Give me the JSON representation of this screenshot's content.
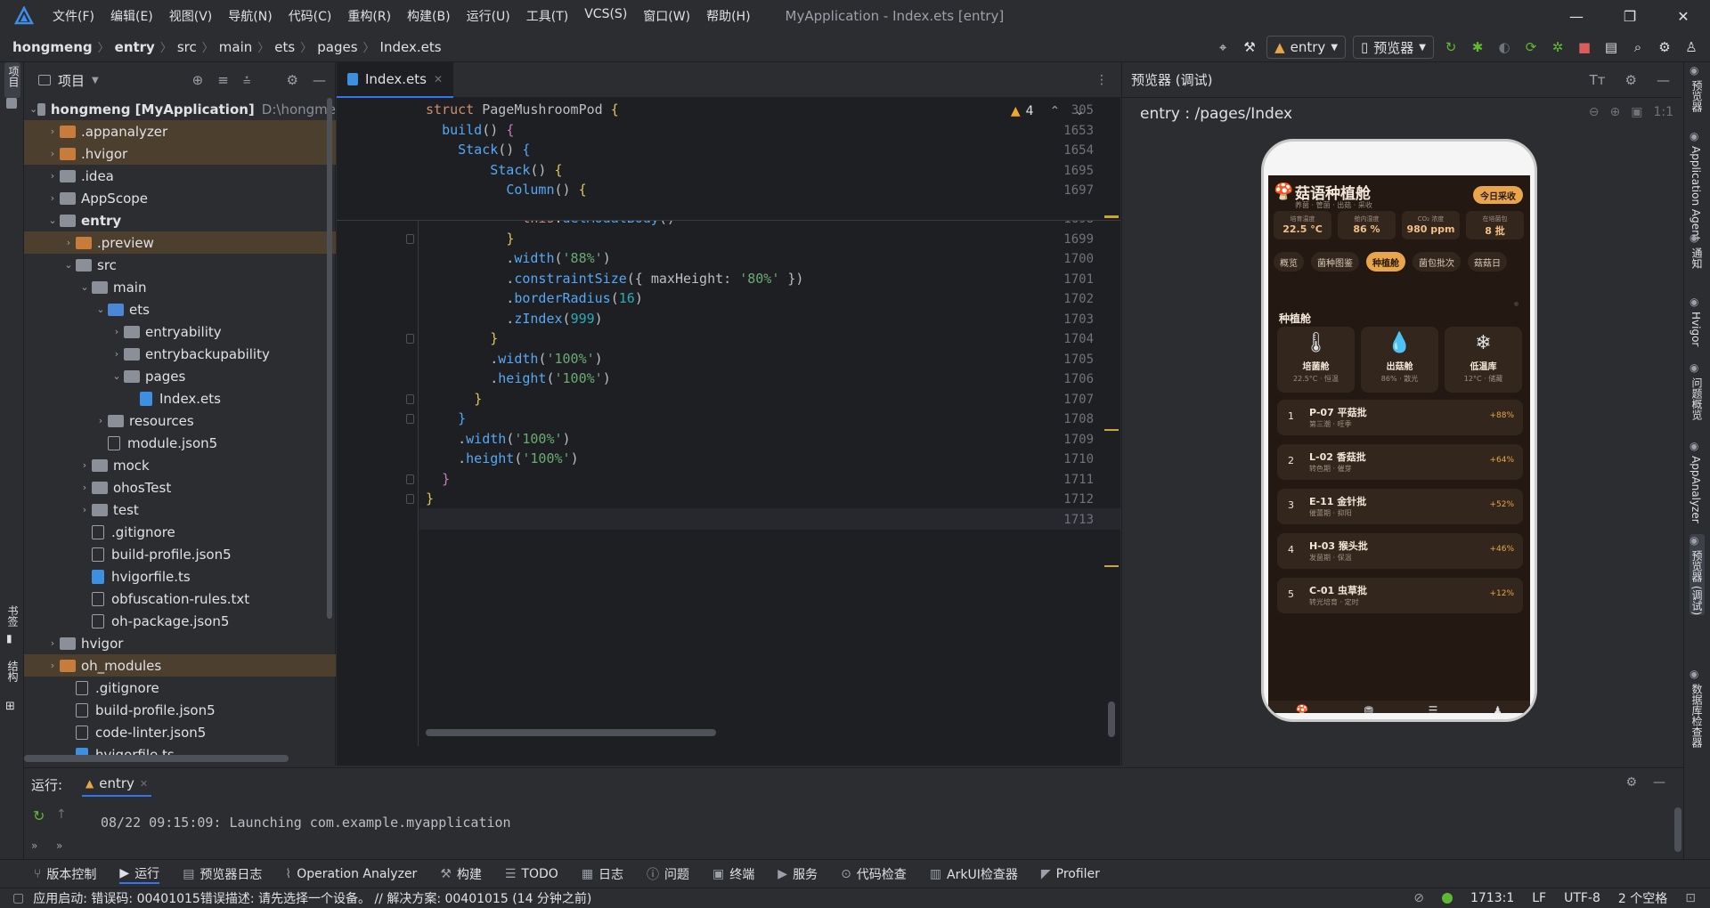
{
  "menu": {
    "items": [
      "文件(F)",
      "编辑(E)",
      "视图(V)",
      "导航(N)",
      "代码(C)",
      "重构(R)",
      "构建(B)",
      "运行(U)",
      "工具(T)",
      "VCS(S)",
      "窗口(W)",
      "帮助(H)"
    ],
    "window_title": "MyApplication - Index.ets [entry]"
  },
  "breadcrumb": [
    "hongmeng",
    "entry",
    "src",
    "main",
    "ets",
    "pages",
    "Index.ets"
  ],
  "toolbar": {
    "run_config": "entry",
    "device": "预览器"
  },
  "left_strip": {
    "project": "项目",
    "bookmarks": "书签",
    "structure": "结构"
  },
  "project": {
    "title": "项目",
    "tree": [
      {
        "label": "hongmeng [MyApplication]",
        "extra": "D:\\hongme",
        "depth": 0,
        "kind": "root",
        "open": true
      },
      {
        "label": ".appanalyzer",
        "depth": 1,
        "kind": "orange",
        "open": false,
        "hl": true
      },
      {
        "label": ".hvigor",
        "depth": 1,
        "kind": "orange",
        "open": false,
        "hl": true
      },
      {
        "label": ".idea",
        "depth": 1,
        "kind": "gray",
        "open": false
      },
      {
        "label": "AppScope",
        "depth": 1,
        "kind": "gray",
        "open": false
      },
      {
        "label": "entry",
        "depth": 1,
        "kind": "gray",
        "open": true,
        "bold": true
      },
      {
        "label": ".preview",
        "depth": 2,
        "kind": "orange",
        "open": false,
        "hl": true
      },
      {
        "label": "src",
        "depth": 2,
        "kind": "gray",
        "open": true
      },
      {
        "label": "main",
        "depth": 3,
        "kind": "gray",
        "open": true
      },
      {
        "label": "ets",
        "depth": 4,
        "kind": "blue",
        "open": true
      },
      {
        "label": "entryability",
        "depth": 5,
        "kind": "gray",
        "open": false
      },
      {
        "label": "entrybackupability",
        "depth": 5,
        "kind": "gray",
        "open": false
      },
      {
        "label": "pages",
        "depth": 5,
        "kind": "gray",
        "open": true
      },
      {
        "label": "Index.ets",
        "depth": 6,
        "kind": "ets"
      },
      {
        "label": "resources",
        "depth": 4,
        "kind": "gray",
        "open": false
      },
      {
        "label": "module.json5",
        "depth": 4,
        "kind": "json"
      },
      {
        "label": "mock",
        "depth": 3,
        "kind": "gray",
        "open": false
      },
      {
        "label": "ohosTest",
        "depth": 3,
        "kind": "gray",
        "open": false
      },
      {
        "label": "test",
        "depth": 3,
        "kind": "gray",
        "open": false
      },
      {
        "label": ".gitignore",
        "depth": 3,
        "kind": "file"
      },
      {
        "label": "build-profile.json5",
        "depth": 3,
        "kind": "json"
      },
      {
        "label": "hvigorfile.ts",
        "depth": 3,
        "kind": "ts"
      },
      {
        "label": "obfuscation-rules.txt",
        "depth": 3,
        "kind": "file"
      },
      {
        "label": "oh-package.json5",
        "depth": 3,
        "kind": "json"
      },
      {
        "label": "hvigor",
        "depth": 1,
        "kind": "gray",
        "open": false
      },
      {
        "label": "oh_modules",
        "depth": 1,
        "kind": "orange",
        "open": false,
        "hl": true
      },
      {
        "label": ".gitignore",
        "depth": 2,
        "kind": "file"
      },
      {
        "label": "build-profile.json5",
        "depth": 2,
        "kind": "json"
      },
      {
        "label": "code-linter.json5",
        "depth": 2,
        "kind": "json"
      },
      {
        "label": "hvigorfile.ts",
        "depth": 2,
        "kind": "ts"
      }
    ]
  },
  "editor": {
    "tab": "Index.ets",
    "warnings": "4",
    "sticky": [
      {
        "ln": "305",
        "html": "<span class='kw'>struct</span> <span class='gr'>PageMushroomPod</span> <span class='yl'>{</span>"
      },
      {
        "ln": "1653",
        "html": "  <span class='fn'>build</span><span class='gr'>()</span> <span class='pk'>{</span>"
      },
      {
        "ln": "1654",
        "html": "    <span class='fn'>Stack</span><span class='gr'>()</span> <span class='fn'>{</span>"
      },
      {
        "ln": "1695",
        "html": "        <span class='fn'>Stack</span><span class='gr'>()</span> <span class='yl'>{</span>"
      },
      {
        "ln": "1697",
        "html": "          <span class='fn'>Column</span><span class='gr'>()</span> <span class='yl'>{</span>"
      }
    ],
    "lines": [
      {
        "ln": "1698",
        "html": "            <span class='kw'>this</span>.<span class='fn'>delModalBody</span>()"
      },
      {
        "ln": "1699",
        "html": "          <span class='yl'>}</span>"
      },
      {
        "ln": "1700",
        "html": "          .<span class='fn'>width</span>(<span class='st'>'88%'</span>)"
      },
      {
        "ln": "1701",
        "html": "          .<span class='fn'>constraintSize</span>({ maxHeight: <span class='st'>'80%'</span> })"
      },
      {
        "ln": "1702",
        "html": "          .<span class='fn'>borderRadius</span>(<span class='nm'>16</span>)"
      },
      {
        "ln": "1703",
        "html": "          .<span class='fn'>zIndex</span>(<span class='nm'>999</span>)"
      },
      {
        "ln": "1704",
        "html": "        <span class='yl'>}</span>"
      },
      {
        "ln": "1705",
        "html": "        .<span class='fn'>width</span>(<span class='st'>'100%'</span>)"
      },
      {
        "ln": "1706",
        "html": "        .<span class='fn'>height</span>(<span class='st'>'100%'</span>)"
      },
      {
        "ln": "1707",
        "html": "      <span class='yl'>}</span>"
      },
      {
        "ln": "1708",
        "html": "    <span class='fn'>}</span>"
      },
      {
        "ln": "1709",
        "html": "    .<span class='fn'>width</span>(<span class='st'>'100%'</span>)"
      },
      {
        "ln": "1710",
        "html": "    .<span class='fn'>height</span>(<span class='st'>'100%'</span>)"
      },
      {
        "ln": "1711",
        "html": "  <span class='pk'>}</span>"
      },
      {
        "ln": "1712",
        "html": "<span class='yl'>}</span>"
      },
      {
        "ln": "1713",
        "html": ""
      }
    ]
  },
  "preview": {
    "title": "预览器 (调试)",
    "path": "entry : /pages/Index",
    "zoom": "1:1",
    "app": {
      "title": "菇语种植舱",
      "subtitle": "养菌 · 管菌 · 出菇 · 采收",
      "harvest_btn": "今日采收",
      "metrics": [
        {
          "label": "培育温度",
          "value": "22.5 °C"
        },
        {
          "label": "舱内湿度",
          "value": "86 %"
        },
        {
          "label": "CO₂ 浓度",
          "value": "980 ppm"
        },
        {
          "label": "在培菌包",
          "value": "8 批"
        }
      ],
      "chips": [
        "概览",
        "菌种图鉴",
        "种植舱",
        "菌包批次",
        "菇菇日"
      ],
      "active_chip": "种植舱",
      "section": "种植舱",
      "cards": [
        {
          "icon": "🌡",
          "name": "培菌舱",
          "sub": "22.5°C · 恒温"
        },
        {
          "icon": "💧",
          "name": "出菇舱",
          "sub": "86% · 散光"
        },
        {
          "icon": "❄",
          "name": "低温库",
          "sub": "12°C · 储藏"
        }
      ],
      "batches": [
        {
          "idx": "1",
          "name": "P-07 平菇批",
          "sub": "第三潮 · 旺季",
          "pct": "+88%"
        },
        {
          "idx": "2",
          "name": "L-02 香菇批",
          "sub": "转色期 · 催芽",
          "pct": "+64%"
        },
        {
          "idx": "3",
          "name": "E-11 金针批",
          "sub": "催蕾期 · 抑阳",
          "pct": "+52%"
        },
        {
          "idx": "4",
          "name": "H-03 猴头批",
          "sub": "发菌期 · 保温",
          "pct": "+46%"
        },
        {
          "idx": "5",
          "name": "C-01 虫草批",
          "sub": "转光培育 · 定时",
          "pct": "+12%"
        }
      ]
    }
  },
  "right_strip": [
    "预览器",
    "Application Agent",
    "通知",
    "Hvigor",
    "问题概览",
    "AppAnalyzer",
    "预览器 (调试)",
    "数据库检查器"
  ],
  "run": {
    "label": "运行:",
    "tab": "entry",
    "log": "08/22 09:15:09: Launching com.example.myapplication"
  },
  "tool_windows": [
    "版本控制",
    "运行",
    "预览器日志",
    "Operation Analyzer",
    "构建",
    "TODO",
    "日志",
    "问题",
    "终端",
    "服务",
    "代码检查",
    "ArkUI检查器",
    "Profiler"
  ],
  "status": {
    "message": "应用启动: 错误码: 00401015错误描述: 请先选择一个设备。 // 解决方案: 00401015 (14 分钟之前)",
    "position": "1713:1",
    "line_sep": "LF",
    "encoding": "UTF-8",
    "indent": "2 个空格"
  },
  "colors": {
    "accent": "#3574f0",
    "bg": "#2b2d30",
    "editor_bg": "#1e1f22",
    "app_bg": "#231812",
    "app_accent": "#e8a54b"
  }
}
